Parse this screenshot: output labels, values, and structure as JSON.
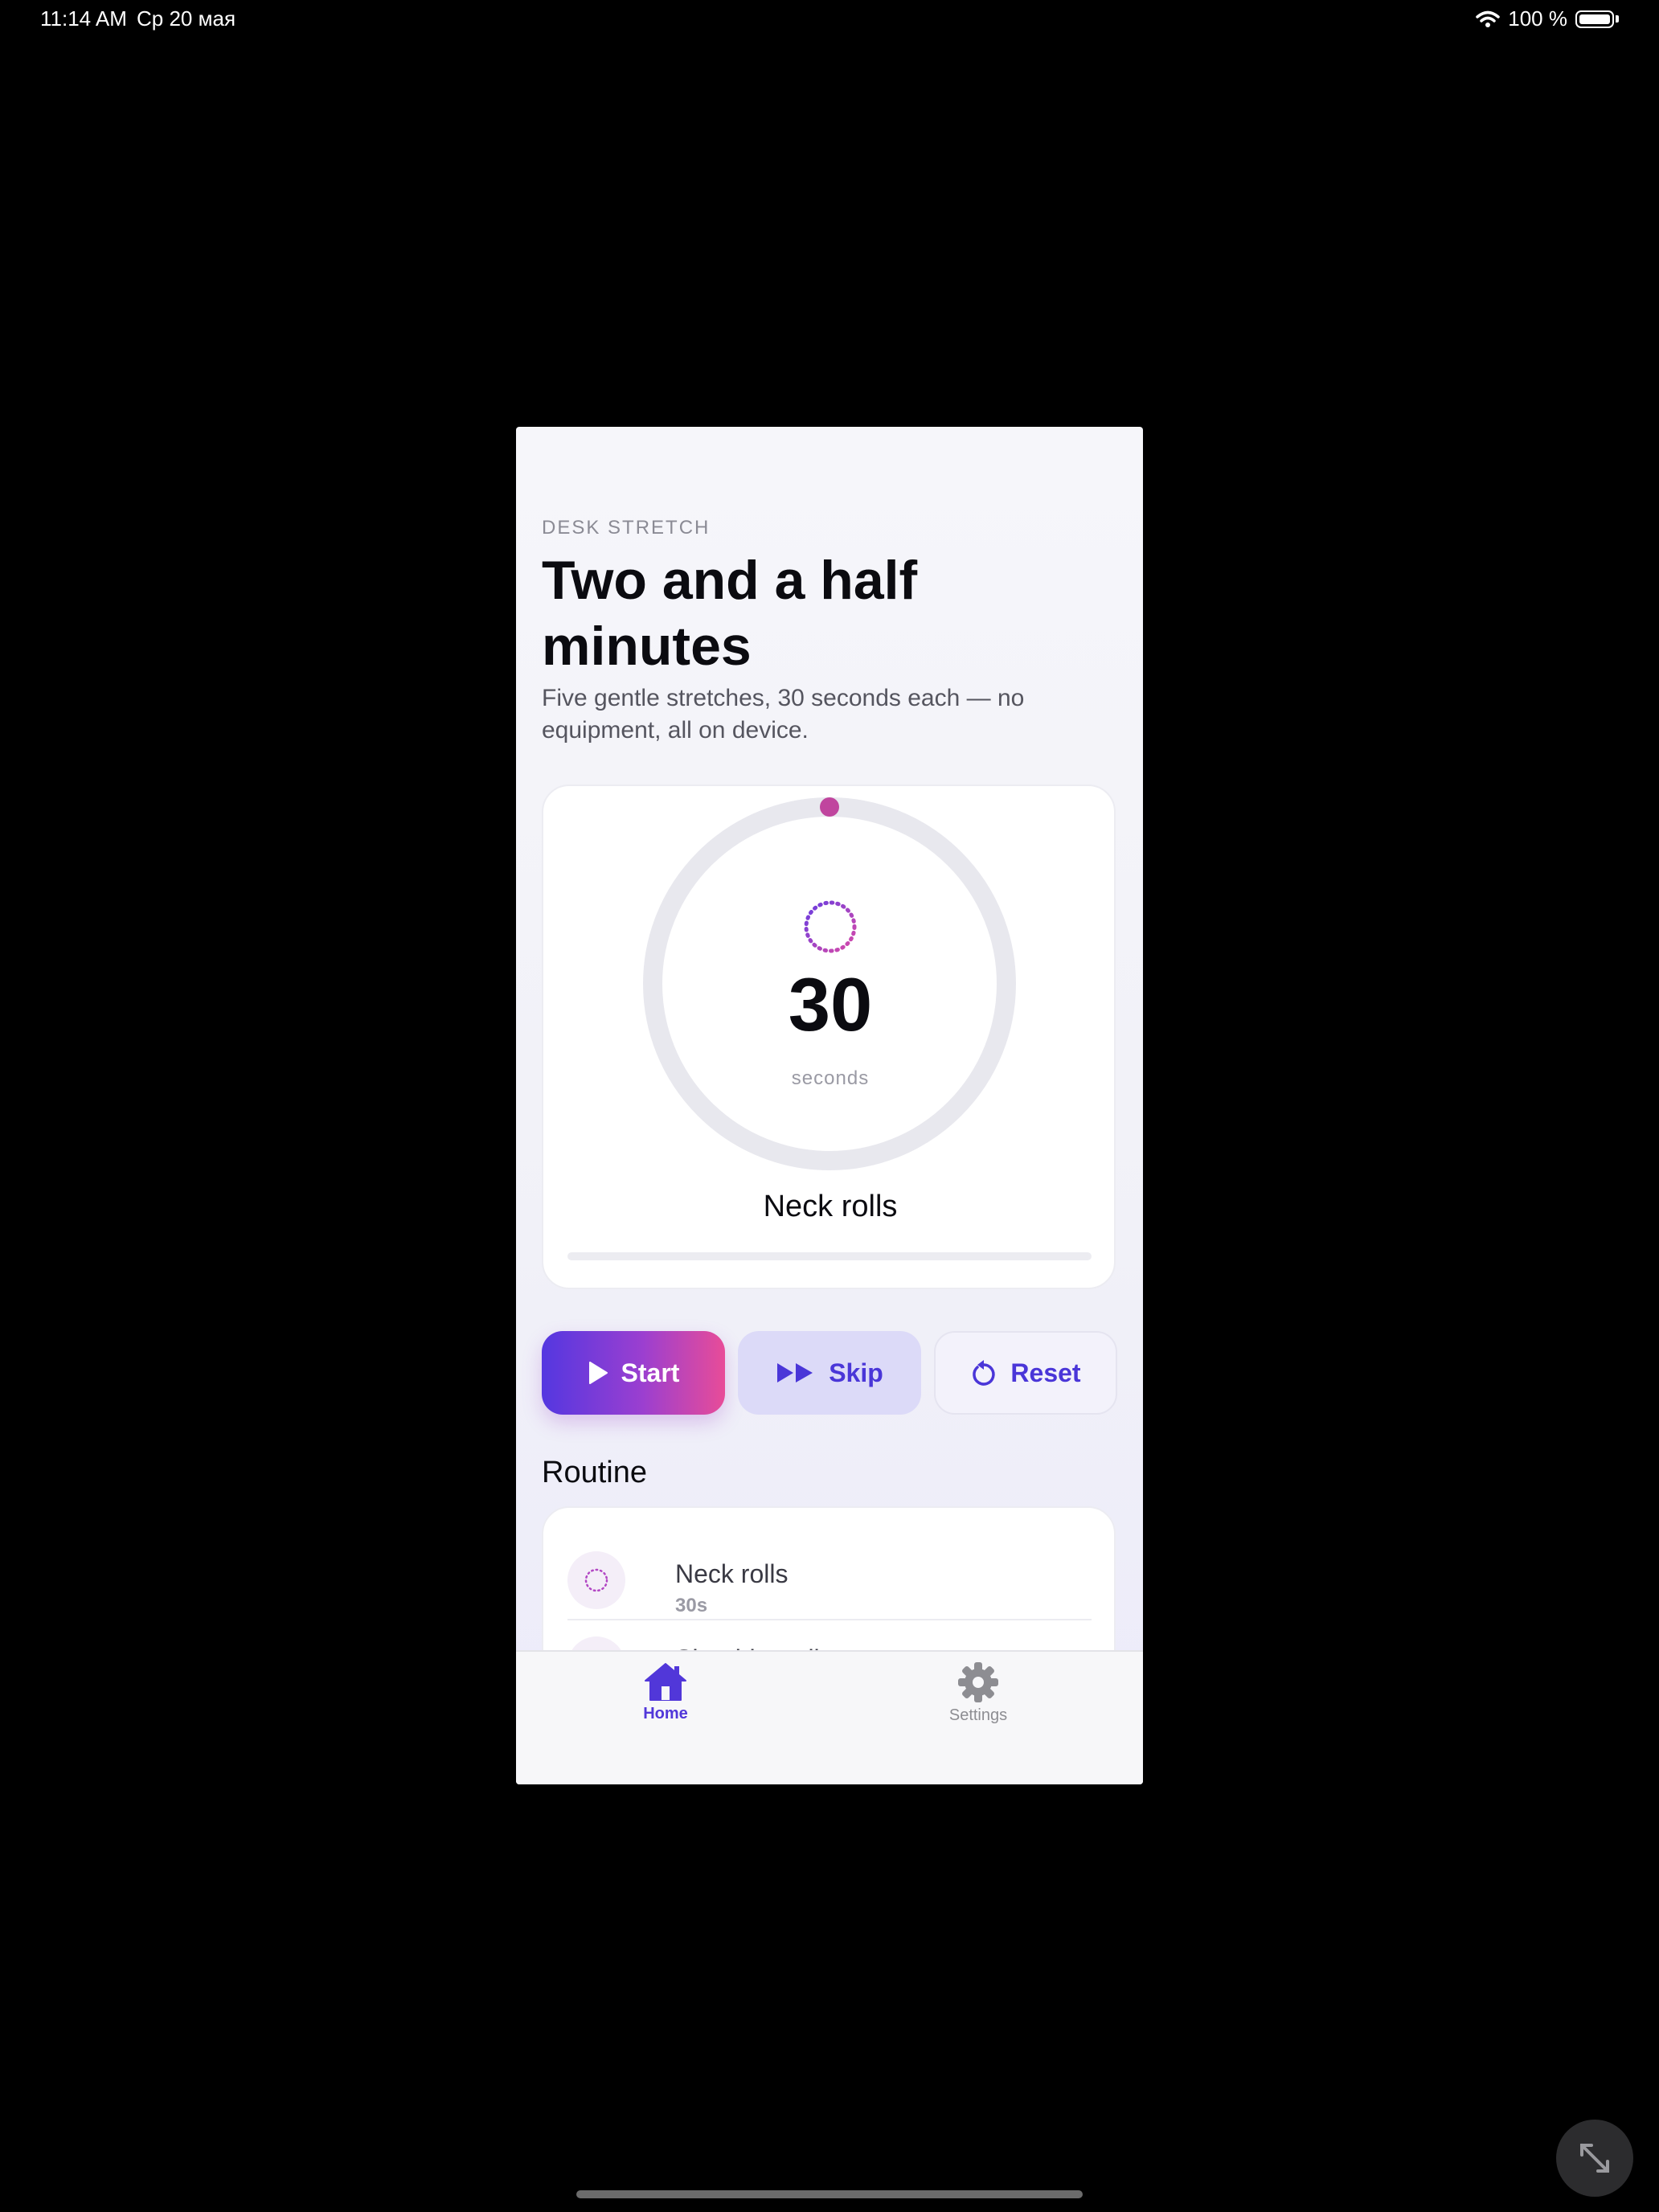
{
  "status_bar": {
    "time": "11:14 AM",
    "date": "Ср 20 мая",
    "battery": "100 %"
  },
  "header": {
    "eyebrow": "DESK STRETCH",
    "title": "Two and a half minutes",
    "subtitle": "Five gentle stretches, 30 seconds each — no equipment, all on device."
  },
  "timer": {
    "count": "30",
    "unit": "seconds",
    "exercise": "Neck rolls",
    "progress": 0
  },
  "controls": {
    "start_label": "Start",
    "skip_label": "Skip",
    "reset_label": "Reset"
  },
  "routine": {
    "heading": "Routine",
    "items": [
      {
        "name": "Neck rolls",
        "duration": "30s"
      },
      {
        "name": "Shoulder rolls"
      }
    ]
  },
  "tabs": {
    "home_label": "Home",
    "settings_label": "Settings"
  },
  "colors": {
    "accent": "#5137d9",
    "gradient_start": "#5437e0",
    "gradient_end": "#e84c98",
    "ring_track": "#e8e8ee",
    "ring_knob": "#c0459e"
  }
}
